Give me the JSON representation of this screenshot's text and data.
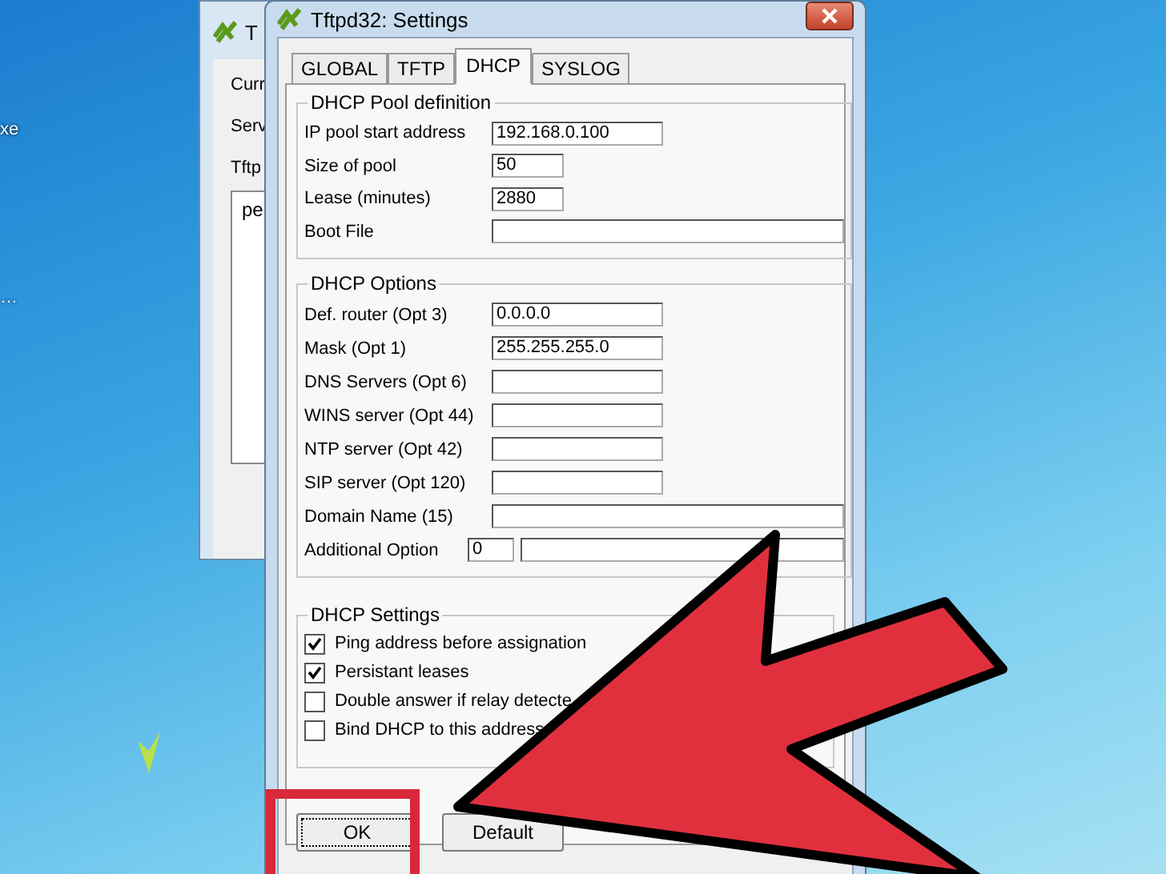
{
  "desktop": {
    "icon_labels": [
      "xe",
      "…"
    ]
  },
  "back_window": {
    "title": "T",
    "labels": [
      "Curr",
      "Serv"
    ],
    "tab": "Tftp",
    "column_1": "pe"
  },
  "dialog": {
    "title": "Tftpd32: Settings",
    "tabs": [
      {
        "label": "GLOBAL",
        "selected": false
      },
      {
        "label": "TFTP",
        "selected": false
      },
      {
        "label": "DHCP",
        "selected": true
      },
      {
        "label": "SYSLOG",
        "selected": false
      }
    ],
    "pool": {
      "title": "DHCP Pool definition",
      "fields": [
        {
          "label": "IP pool start address",
          "value": "192.168.0.100",
          "kind": "medium"
        },
        {
          "label": "Size of pool",
          "value": "50",
          "kind": "short"
        },
        {
          "label": "Lease (minutes)",
          "value": "2880",
          "kind": "short"
        },
        {
          "label": "Boot File",
          "kind": "long"
        }
      ]
    },
    "options": {
      "title": "DHCP Options",
      "fields": [
        {
          "label": "Def. router (Opt 3)",
          "value": "0.0.0.0",
          "kind": "medium"
        },
        {
          "label": "Mask (Opt 1)",
          "value": "255.255.255.0",
          "kind": "medium"
        },
        {
          "label": "DNS Servers (Opt 6)",
          "kind": "medium"
        },
        {
          "label": "WINS server (Opt 44)",
          "kind": "medium"
        },
        {
          "label": "NTP server (Opt 42)",
          "kind": "medium"
        },
        {
          "label": "SIP server (Opt 120)",
          "kind": "medium"
        },
        {
          "label": "Domain Name (15)",
          "kind": "long"
        },
        {
          "label": "Additional Option",
          "value": "0",
          "kind": "pair"
        }
      ]
    },
    "settings": {
      "title": "DHCP Settings",
      "checkboxes": [
        {
          "label": "Ping address before assignation",
          "checked": true
        },
        {
          "label": "Persistant leases",
          "checked": true
        },
        {
          "label": "Double answer if relay detecte",
          "checked": false
        },
        {
          "label": "Bind DHCP to this address",
          "checked": false
        }
      ]
    },
    "buttons": [
      {
        "label": "OK",
        "focused": true,
        "highlighted": true
      },
      {
        "label": "Default",
        "focused": false,
        "highlighted": false
      }
    ]
  }
}
